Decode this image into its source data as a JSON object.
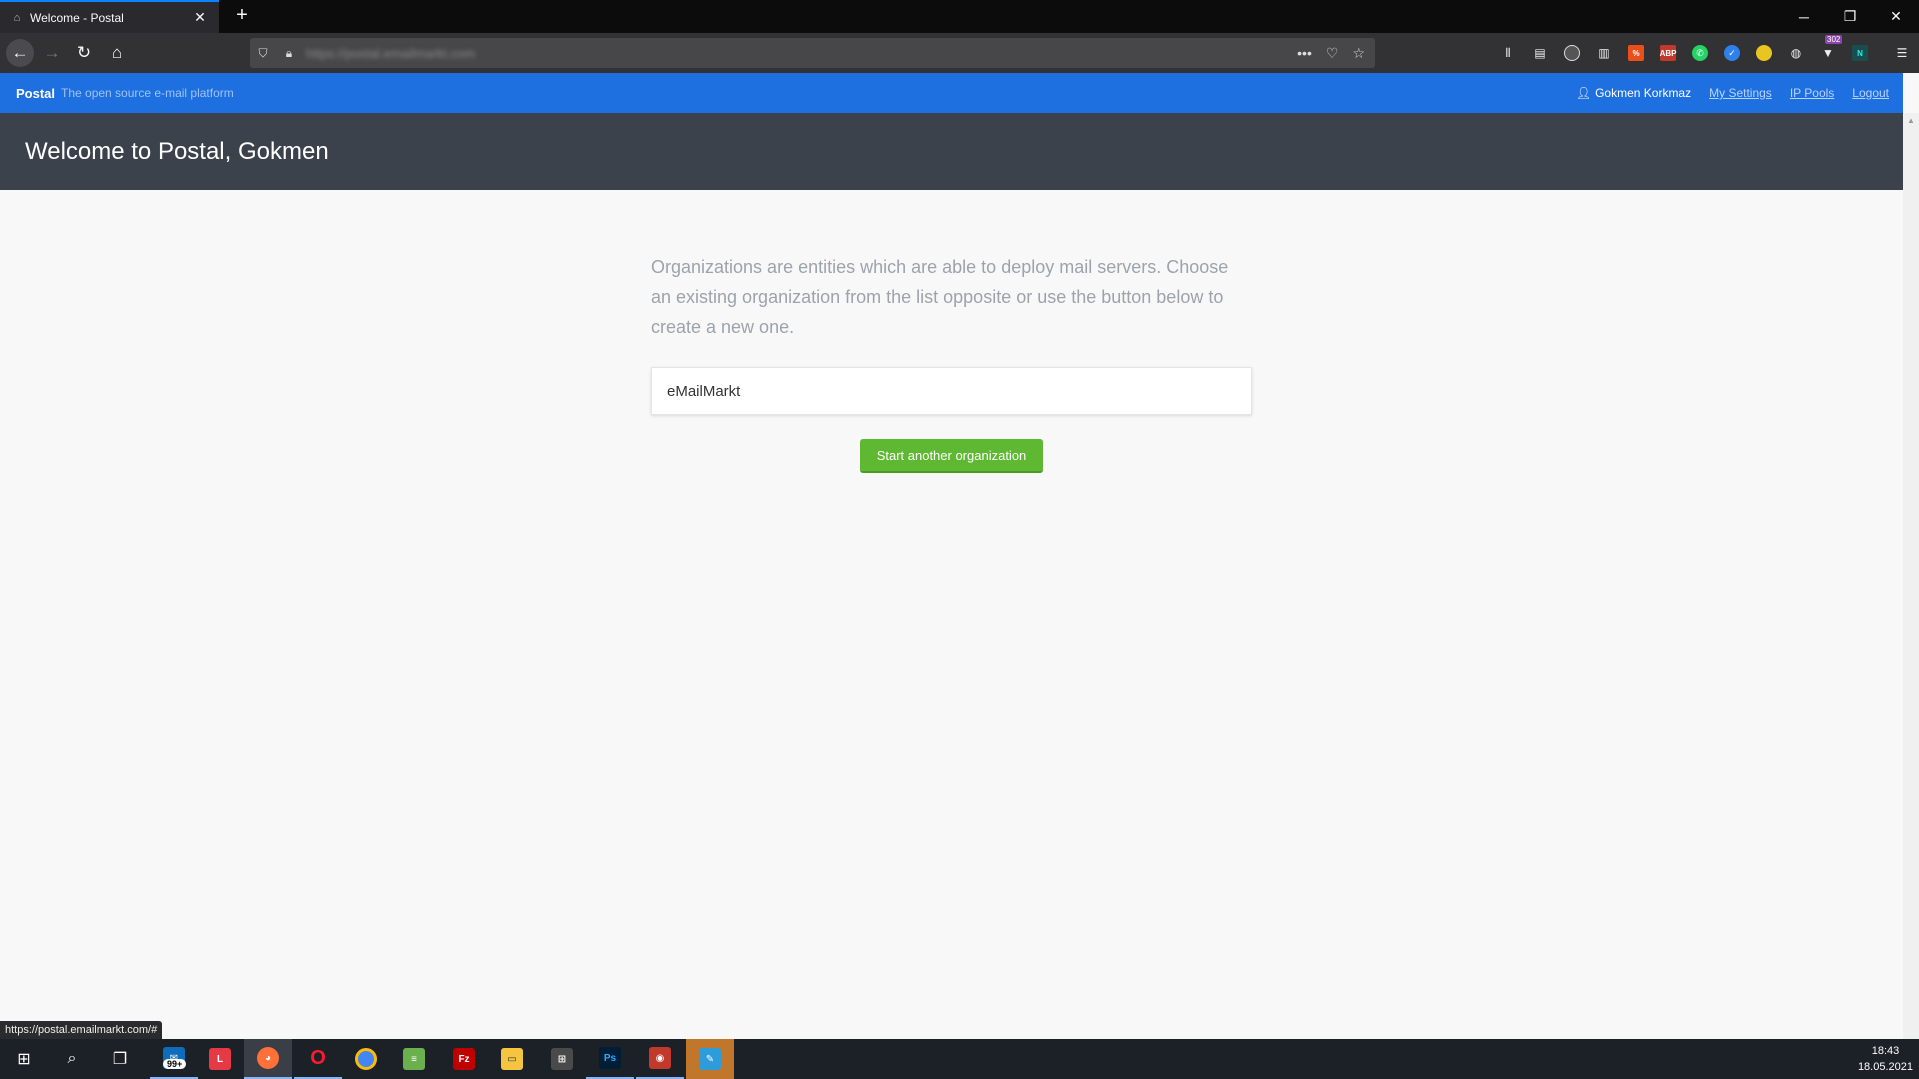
{
  "browser": {
    "tab_title": "Welcome - Postal",
    "tab_close": "✕",
    "new_tab": "+",
    "url": "https://postal.emailmarkt.com",
    "window_controls": [
      "─",
      "❐",
      "✕"
    ],
    "extension_badge": "302"
  },
  "app": {
    "brand": "Postal",
    "tagline": "The open source e-mail platform",
    "user_name": "Gokmen Korkmaz",
    "links": {
      "settings": "My Settings",
      "ip_pools": "IP Pools",
      "logout": "Logout"
    }
  },
  "page": {
    "title": "Welcome to Postal, Gokmen",
    "intro": "Organizations are entities which are able to deploy mail servers. Choose an existing organization from the list opposite or use the button below to create a new one.",
    "organizations": [
      "eMailMarkt"
    ],
    "new_org_button": "Start another organization"
  },
  "status_bar": {
    "hover_url": "https://postal.emailmarkt.com/#"
  },
  "taskbar": {
    "mail_badge": "99+",
    "time": "18:43",
    "date": "18.05.2021"
  },
  "colors": {
    "app_bar": "#1e6fe0",
    "page_header": "#3c424b",
    "primary_button": "#5fb832"
  }
}
